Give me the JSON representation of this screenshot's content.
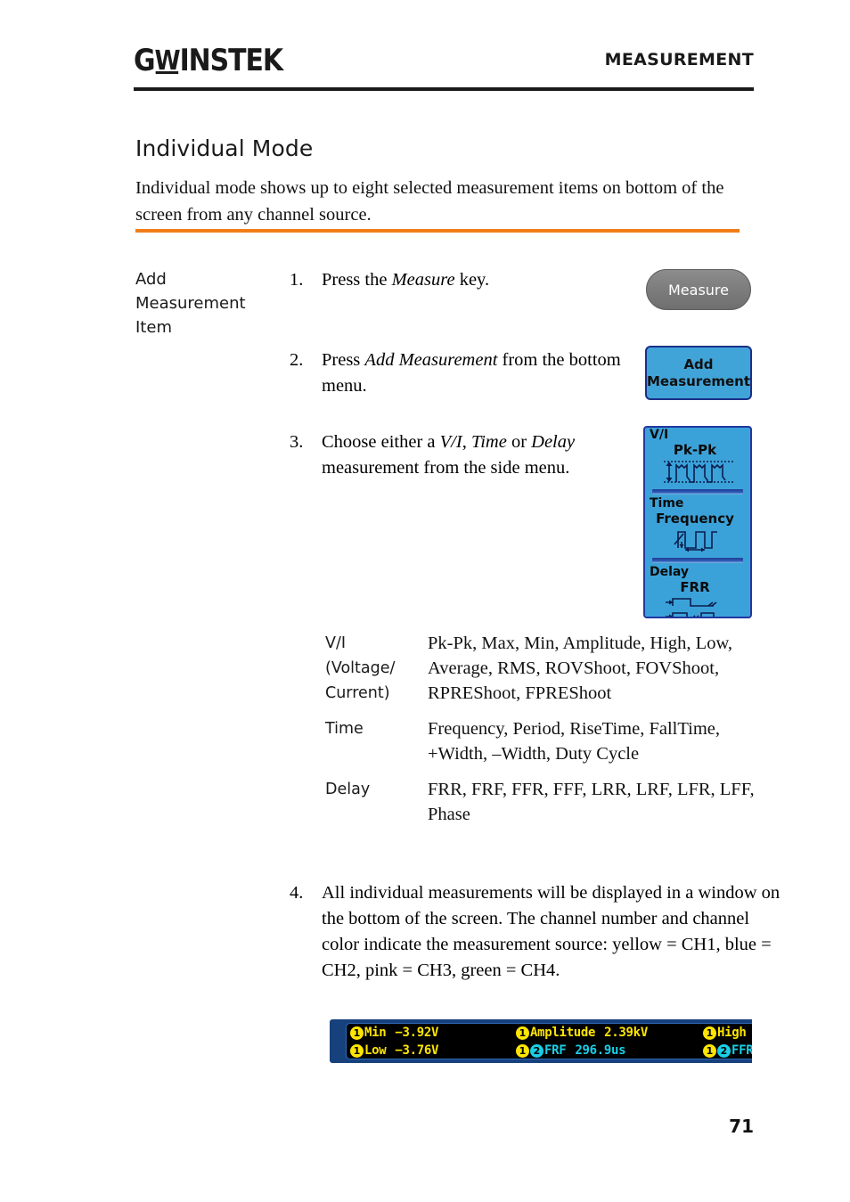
{
  "header": {
    "logo_prefix": "G",
    "logo_w": "W",
    "logo_suffix": "INSTEK",
    "title": "MEASUREMENT"
  },
  "section": {
    "title": "Individual Mode",
    "intro": "Individual mode shows up to eight selected measurement items on bottom of the screen from any channel source."
  },
  "label_column": {
    "line1": "Add",
    "line2": "Measurement",
    "line3": "Item"
  },
  "steps": [
    {
      "number": "1.",
      "text_before": "Press the ",
      "emphasis": "Measure",
      "text_after": " key."
    },
    {
      "number": "2.",
      "text_before": "Press ",
      "emphasis": "Add Measurement",
      "text_after": " from the bottom menu."
    },
    {
      "number": "3.",
      "text_before": "Choose either a ",
      "emphasis1": "V/I",
      "sep1": ", ",
      "emphasis2": "Time",
      "sep2": " or ",
      "emphasis3": "Delay",
      "text_after": " measurement from the side menu."
    },
    {
      "number": "4.",
      "text": "All individual measurements will be displayed in a window on the bottom of the screen. The channel number and channel color indicate the measurement source: yellow = CH1, blue = CH2, pink = CH3, green = CH4."
    }
  ],
  "measure_key": {
    "label": "Measure"
  },
  "softkey": {
    "line1": "Add",
    "line2": "Measurement"
  },
  "side_menu": {
    "blocks": [
      {
        "head": "V/I",
        "sub": "Pk-Pk",
        "icon": "peak-to-peak-waveform-icon"
      },
      {
        "head": "Time",
        "sub": "Frequency",
        "icon": "frequency-waveform-icon"
      },
      {
        "head": "Delay",
        "sub": "FRR",
        "icon": "delay-frr-waveform-icon"
      }
    ]
  },
  "type_table": {
    "rows": [
      {
        "key": "V/I\n(Voltage/\nCurrent)",
        "key_line1": "V/I",
        "key_line2": "(Voltage/",
        "key_line3": "Current)",
        "value": "Pk-Pk, Max, Min, Amplitude, High, Low, Average, RMS, ROVShoot, FOVShoot, RPREShoot, FPREShoot"
      },
      {
        "key_line1": "Time",
        "key_line2": "",
        "key_line3": "",
        "value": "Frequency, Period, RiseTime, FallTime, +Width, –Width, Duty Cycle"
      },
      {
        "key_line1": "Delay",
        "key_line2": "",
        "key_line3": "",
        "value": "FRR, FRF, FFR, FFF, LRR, LRF, LFR, LFF, Phase"
      }
    ]
  },
  "readout": {
    "row1": {
      "cell1": {
        "badges": [
          "1"
        ],
        "label": "Min",
        "value": "−3.92V"
      },
      "cell2": {
        "badges": [
          "1"
        ],
        "label": "Amplitude",
        "value": "2.39kV"
      },
      "cell3": {
        "badges": [
          "1"
        ],
        "label": "High",
        "value": ""
      }
    },
    "row2": {
      "cell1": {
        "badges": [
          "1"
        ],
        "label": "Low",
        "value": "−3.76V"
      },
      "cell2": {
        "badges": [
          "1",
          "2"
        ],
        "label": "FRF",
        "value": "296.9us"
      },
      "cell3": {
        "badges": [
          "1",
          "2"
        ],
        "label": "FFR",
        "value": ""
      }
    }
  },
  "colors": {
    "accent_orange": "#f07d1a",
    "panel_blue": "#3ba2d9",
    "border_navy": "#2337a0",
    "ch1_yellow": "#ffe500",
    "ch2_cyan": "#19cfe8",
    "readout_frame": "#17417d"
  },
  "page_number": "71"
}
